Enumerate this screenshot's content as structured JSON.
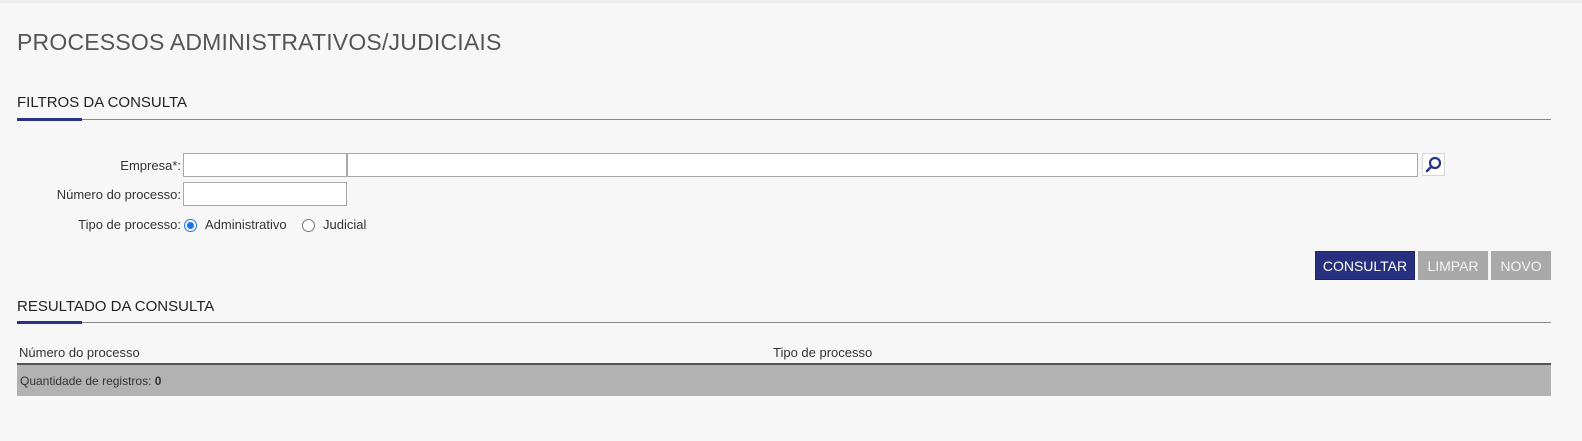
{
  "page": {
    "title": "PROCESSOS ADMINISTRATIVOS/JUDICIAIS"
  },
  "filters": {
    "section_title": "FILTROS DA CONSULTA",
    "empresa": {
      "label": "Empresa*:",
      "code_value": "",
      "name_value": "",
      "search_icon": "magnifier-icon"
    },
    "numero_processo": {
      "label": "Número do processo:",
      "value": ""
    },
    "tipo_processo": {
      "label": "Tipo de processo:",
      "options": [
        {
          "label": "Administrativo",
          "selected": true
        },
        {
          "label": "Judicial",
          "selected": false
        }
      ]
    }
  },
  "actions": {
    "consultar_label": "CONSULTAR",
    "limpar_label": "LIMPAR",
    "novo_label": "NOVO"
  },
  "results": {
    "section_title": "RESULTADO DA CONSULTA",
    "columns": [
      "Número do processo",
      "Tipo de processo"
    ],
    "rows": [],
    "count_label": "Quantidade de registros:",
    "count_value": "0"
  },
  "colors": {
    "accent": "#2a3487",
    "primary_button": "#27307e",
    "disabled_button": "#a9a9a9",
    "radio_selected": "#1a73e8",
    "footer_bar": "#b2b2b2",
    "background": "#f7f7f7"
  }
}
